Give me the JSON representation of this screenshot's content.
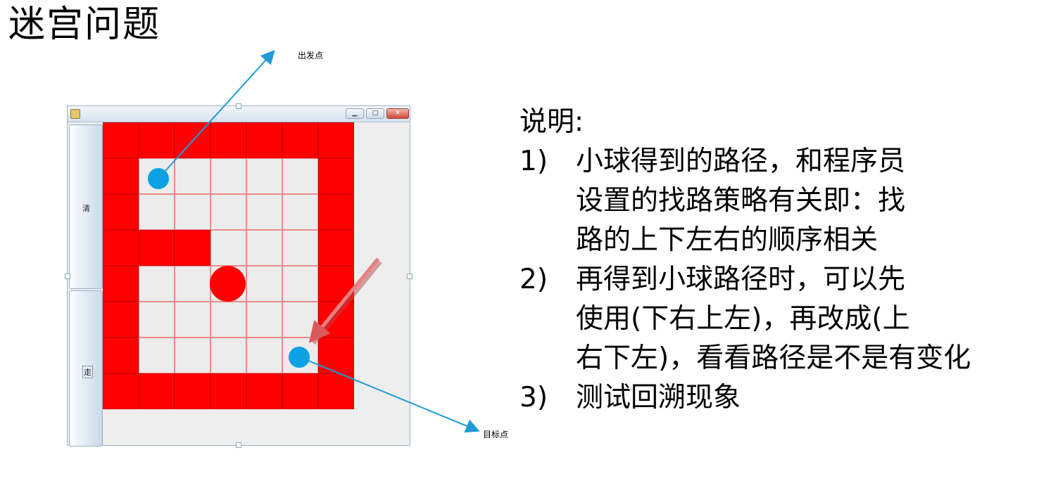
{
  "title": "迷宫问题",
  "callouts": {
    "start": "出发点",
    "goal": "目标点"
  },
  "window": {
    "buttons": {
      "clear": "清",
      "go": "走"
    },
    "maze": {
      "rows": [
        [
          1,
          1,
          1,
          1,
          1,
          1,
          1
        ],
        [
          1,
          0,
          0,
          0,
          0,
          0,
          1
        ],
        [
          1,
          0,
          0,
          0,
          0,
          0,
          1
        ],
        [
          1,
          1,
          1,
          0,
          0,
          0,
          1
        ],
        [
          1,
          0,
          0,
          0,
          0,
          0,
          1
        ],
        [
          1,
          0,
          0,
          0,
          0,
          0,
          1
        ],
        [
          1,
          0,
          0,
          0,
          0,
          0,
          1
        ],
        [
          1,
          1,
          1,
          1,
          1,
          1,
          1
        ]
      ]
    }
  },
  "description": {
    "heading": "说明:",
    "items": [
      {
        "num": "1)",
        "lines": [
          "小球得到的路径，和程序员",
          "设置的找路策略有关即：找",
          "路的上下左右的顺序相关"
        ]
      },
      {
        "num": "2)",
        "lines": [
          "再得到小球路径时，可以先",
          "使用(下右上左)，再改成(上",
          "右下左)，看看路径是不是有变化"
        ]
      },
      {
        "num": "3)",
        "lines": [
          "测试回溯现象"
        ]
      }
    ]
  },
  "colors": {
    "wall": "#ff0000",
    "empty": "#ececec",
    "marker_dot": "#0aa0e6",
    "ball": "#ff0000",
    "pointer_arrow": "#e88080"
  }
}
